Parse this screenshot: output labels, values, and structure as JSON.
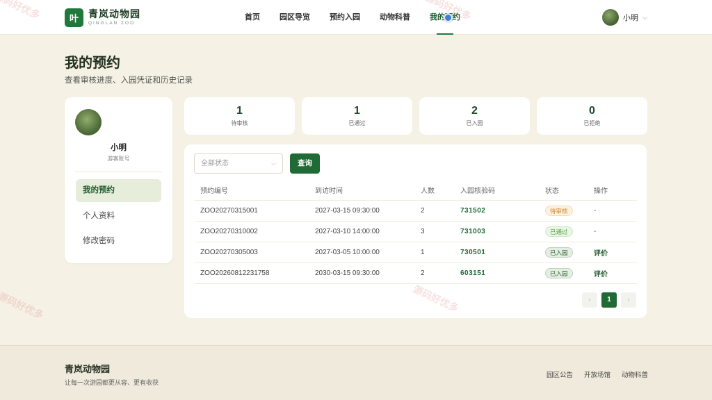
{
  "brand": {
    "logo_char": "叶",
    "name": "青岚动物园",
    "subtitle": "QINGLAN ZOO"
  },
  "nav": [
    {
      "label": "首页",
      "active": false
    },
    {
      "label": "园区导览",
      "active": false
    },
    {
      "label": "预约入园",
      "active": false
    },
    {
      "label": "动物科普",
      "active": false
    },
    {
      "label": "我的预约",
      "active": true
    }
  ],
  "user": {
    "name": "小明"
  },
  "page": {
    "title": "我的预约",
    "subtitle": "查看审核进度、入园凭证和历史记录"
  },
  "sidebar": {
    "name": "小明",
    "role": "游客账号",
    "items": [
      {
        "label": "我的预约",
        "active": true
      },
      {
        "label": "个人资料",
        "active": false
      },
      {
        "label": "修改密码",
        "active": false
      }
    ]
  },
  "stats": [
    {
      "value": "1",
      "label": "待审核"
    },
    {
      "value": "1",
      "label": "已通过"
    },
    {
      "value": "2",
      "label": "已入园"
    },
    {
      "value": "0",
      "label": "已拒绝"
    }
  ],
  "filter": {
    "placeholder": "全部状态",
    "query_label": "查询"
  },
  "table": {
    "headers": [
      "预约编号",
      "到访时间",
      "人数",
      "入园核验码",
      "状态",
      "操作"
    ],
    "rows": [
      {
        "id": "ZOO20270315001",
        "time": "2027-03-15 09:30:00",
        "count": "2",
        "code": "731502",
        "status": "待审核",
        "action": "-"
      },
      {
        "id": "ZOO20270310002",
        "time": "2027-03-10 14:00:00",
        "count": "3",
        "code": "731003",
        "status": "已通过",
        "action": "-"
      },
      {
        "id": "ZOO20270305003",
        "time": "2027-03-05 10:00:00",
        "count": "1",
        "code": "730501",
        "status": "已入园",
        "action": "评价"
      },
      {
        "id": "ZOO20260812231758",
        "time": "2030-03-15 09:30:00",
        "count": "2",
        "code": "603151",
        "status": "已入园",
        "action": "评价"
      }
    ]
  },
  "pagination": {
    "prev": "‹",
    "current": "1",
    "next": "›"
  },
  "footer": {
    "brand": "青岚动物园",
    "slogan": "让每一次游园都更从容、更有收获",
    "links": [
      "园区公告",
      "开放场馆",
      "动物科普"
    ]
  },
  "watermark": "源码好优多",
  "colors": {
    "primary": "#1f6a35",
    "background": "#f5f1e4",
    "pending": "#d0892e",
    "approved": "#58a04a"
  }
}
